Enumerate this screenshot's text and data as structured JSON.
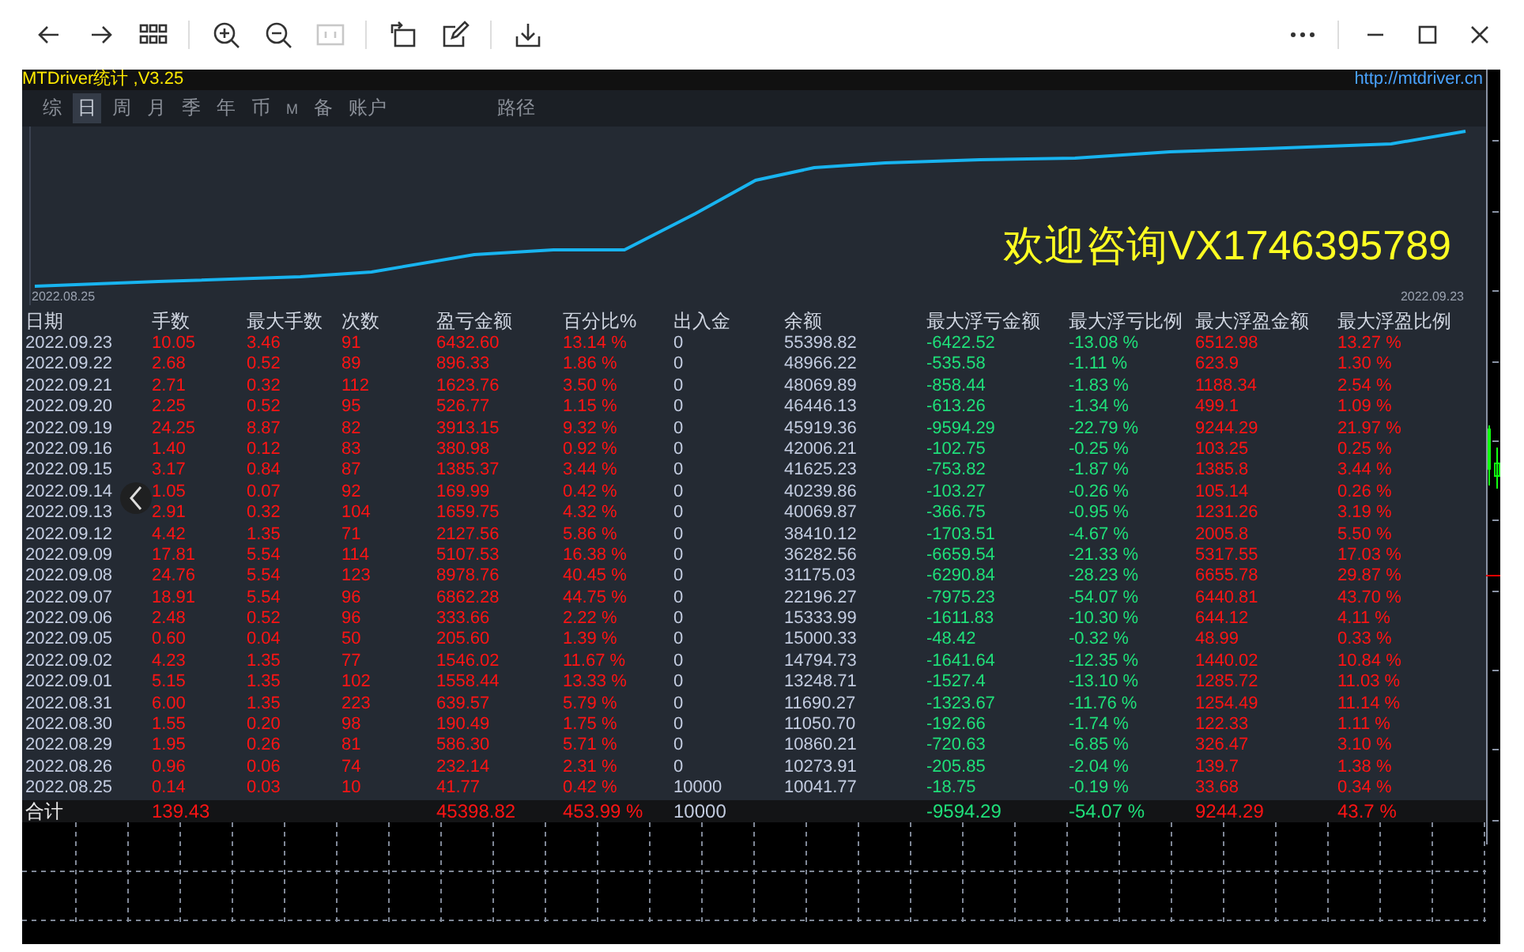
{
  "toolbar": {
    "left": [
      {
        "kind": "back",
        "disabled": false
      },
      {
        "kind": "forward",
        "disabled": false
      },
      {
        "kind": "grid",
        "disabled": false
      },
      {
        "kind": "sep"
      },
      {
        "kind": "zoom-in",
        "disabled": false
      },
      {
        "kind": "zoom-out",
        "disabled": false
      },
      {
        "kind": "actual-size",
        "disabled": true
      },
      {
        "kind": "sep"
      },
      {
        "kind": "rotate",
        "disabled": false
      },
      {
        "kind": "edit",
        "disabled": false
      },
      {
        "kind": "sep"
      },
      {
        "kind": "download",
        "disabled": false
      }
    ],
    "right": [
      {
        "kind": "more",
        "disabled": false
      },
      {
        "kind": "sep"
      },
      {
        "kind": "minimize",
        "disabled": false
      },
      {
        "kind": "maximize",
        "disabled": false
      },
      {
        "kind": "close",
        "disabled": false
      }
    ]
  },
  "app": {
    "title": "MTDriver统计 ,V3.25",
    "link": "http://mtdriver.cn"
  },
  "tabs": [
    {
      "label": "综",
      "selected": false
    },
    {
      "label": "日",
      "selected": true
    },
    {
      "label": "周",
      "selected": false
    },
    {
      "label": "月",
      "selected": false
    },
    {
      "label": "季",
      "selected": false
    },
    {
      "label": "年",
      "selected": false
    },
    {
      "label": "币",
      "selected": false
    },
    {
      "label": "M",
      "selected": false
    },
    {
      "label": "备",
      "selected": false
    },
    {
      "label": "账户",
      "selected": false
    },
    {
      "label": "路径",
      "selected": false
    }
  ],
  "chart": {
    "start_date": "2022.08.25",
    "end_date": "2022.09.23",
    "banner": "欢迎咨询VX1746395789"
  },
  "table": {
    "columns": [
      {
        "label": "日期",
        "kind": "plain"
      },
      {
        "label": "手数",
        "kind": "red"
      },
      {
        "label": "最大手数",
        "kind": "red"
      },
      {
        "label": "次数",
        "kind": "red"
      },
      {
        "label": "盈亏金额",
        "kind": "red"
      },
      {
        "label": "百分比%",
        "kind": "red"
      },
      {
        "label": "出入金",
        "kind": "plain"
      },
      {
        "label": "余额",
        "kind": "plain"
      },
      {
        "label": "最大浮亏金额",
        "kind": "green"
      },
      {
        "label": "最大浮亏比例",
        "kind": "green"
      },
      {
        "label": "最大浮盈金额",
        "kind": "red"
      },
      {
        "label": "最大浮盈比例",
        "kind": "red"
      }
    ],
    "rows": [
      [
        "2022.09.23",
        "10.05",
        "3.46",
        "91",
        "6432.60",
        "13.14 %",
        "0",
        "55398.82",
        "-6422.52",
        "-13.08 %",
        "6512.98",
        "13.27 %"
      ],
      [
        "2022.09.22",
        "2.68",
        "0.52",
        "89",
        "896.33",
        "1.86 %",
        "0",
        "48966.22",
        "-535.58",
        "-1.11 %",
        "623.9",
        "1.30 %"
      ],
      [
        "2022.09.21",
        "2.71",
        "0.32",
        "112",
        "1623.76",
        "3.50 %",
        "0",
        "48069.89",
        "-858.44",
        "-1.83 %",
        "1188.34",
        "2.54 %"
      ],
      [
        "2022.09.20",
        "2.25",
        "0.52",
        "95",
        "526.77",
        "1.15 %",
        "0",
        "46446.13",
        "-613.26",
        "-1.34 %",
        "499.1",
        "1.09 %"
      ],
      [
        "2022.09.19",
        "24.25",
        "8.87",
        "82",
        "3913.15",
        "9.32 %",
        "0",
        "45919.36",
        "-9594.29",
        "-22.79 %",
        "9244.29",
        "21.97 %"
      ],
      [
        "2022.09.16",
        "1.40",
        "0.12",
        "83",
        "380.98",
        "0.92 %",
        "0",
        "42006.21",
        "-102.75",
        "-0.25 %",
        "103.25",
        "0.25 %"
      ],
      [
        "2022.09.15",
        "3.17",
        "0.84",
        "87",
        "1385.37",
        "3.44 %",
        "0",
        "41625.23",
        "-753.82",
        "-1.87 %",
        "1385.8",
        "3.44 %"
      ],
      [
        "2022.09.14",
        "1.05",
        "0.07",
        "92",
        "169.99",
        "0.42 %",
        "0",
        "40239.86",
        "-103.27",
        "-0.26 %",
        "105.14",
        "0.26 %"
      ],
      [
        "2022.09.13",
        "2.91",
        "0.32",
        "104",
        "1659.75",
        "4.32 %",
        "0",
        "40069.87",
        "-366.75",
        "-0.95 %",
        "1231.26",
        "3.19 %"
      ],
      [
        "2022.09.12",
        "4.42",
        "1.35",
        "71",
        "2127.56",
        "5.86 %",
        "0",
        "38410.12",
        "-1703.51",
        "-4.67 %",
        "2005.8",
        "5.50 %"
      ],
      [
        "2022.09.09",
        "17.81",
        "5.54",
        "114",
        "5107.53",
        "16.38 %",
        "0",
        "36282.56",
        "-6659.54",
        "-21.33 %",
        "5317.55",
        "17.03 %"
      ],
      [
        "2022.09.08",
        "24.76",
        "5.54",
        "123",
        "8978.76",
        "40.45 %",
        "0",
        "31175.03",
        "-6290.84",
        "-28.23 %",
        "6655.78",
        "29.87 %"
      ],
      [
        "2022.09.07",
        "18.91",
        "5.54",
        "96",
        "6862.28",
        "44.75 %",
        "0",
        "22196.27",
        "-7975.23",
        "-54.07 %",
        "6440.81",
        "43.70 %"
      ],
      [
        "2022.09.06",
        "2.48",
        "0.52",
        "96",
        "333.66",
        "2.22 %",
        "0",
        "15333.99",
        "-1611.83",
        "-10.30 %",
        "644.12",
        "4.11 %"
      ],
      [
        "2022.09.05",
        "0.60",
        "0.04",
        "50",
        "205.60",
        "1.39 %",
        "0",
        "15000.33",
        "-48.42",
        "-0.32 %",
        "48.99",
        "0.33 %"
      ],
      [
        "2022.09.02",
        "4.23",
        "1.35",
        "77",
        "1546.02",
        "11.67 %",
        "0",
        "14794.73",
        "-1641.64",
        "-12.35 %",
        "1440.02",
        "10.84 %"
      ],
      [
        "2022.09.01",
        "5.15",
        "1.35",
        "102",
        "1558.44",
        "13.33 %",
        "0",
        "13248.71",
        "-1527.4",
        "-13.10 %",
        "1285.72",
        "11.03 %"
      ],
      [
        "2022.08.31",
        "6.00",
        "1.35",
        "223",
        "639.57",
        "5.79 %",
        "0",
        "11690.27",
        "-1323.67",
        "-11.76 %",
        "1254.49",
        "11.14 %"
      ],
      [
        "2022.08.30",
        "1.55",
        "0.20",
        "98",
        "190.49",
        "1.75 %",
        "0",
        "11050.70",
        "-192.66",
        "-1.74 %",
        "122.33",
        "1.11 %"
      ],
      [
        "2022.08.29",
        "1.95",
        "0.26",
        "81",
        "586.30",
        "5.71 %",
        "0",
        "10860.21",
        "-720.63",
        "-6.85 %",
        "326.47",
        "3.10 %"
      ],
      [
        "2022.08.26",
        "0.96",
        "0.06",
        "74",
        "232.14",
        "2.31 %",
        "0",
        "10273.91",
        "-205.85",
        "-2.04 %",
        "139.7",
        "1.38 %"
      ],
      [
        "2022.08.25",
        "0.14",
        "0.03",
        "10",
        "41.77",
        "0.42 %",
        "10000",
        "10041.77",
        "-18.75",
        "-0.19 %",
        "33.68",
        "0.34 %"
      ]
    ],
    "total": {
      "label": "合计",
      "lots": "139.43",
      "profit": "45398.82",
      "percent": "453.99 %",
      "deposit": "10000",
      "max_float_loss": "-9594.29",
      "max_float_loss_pct": "-54.07 %",
      "max_float_profit": "9244.29",
      "max_float_profit_pct": "43.7 %"
    }
  }
}
